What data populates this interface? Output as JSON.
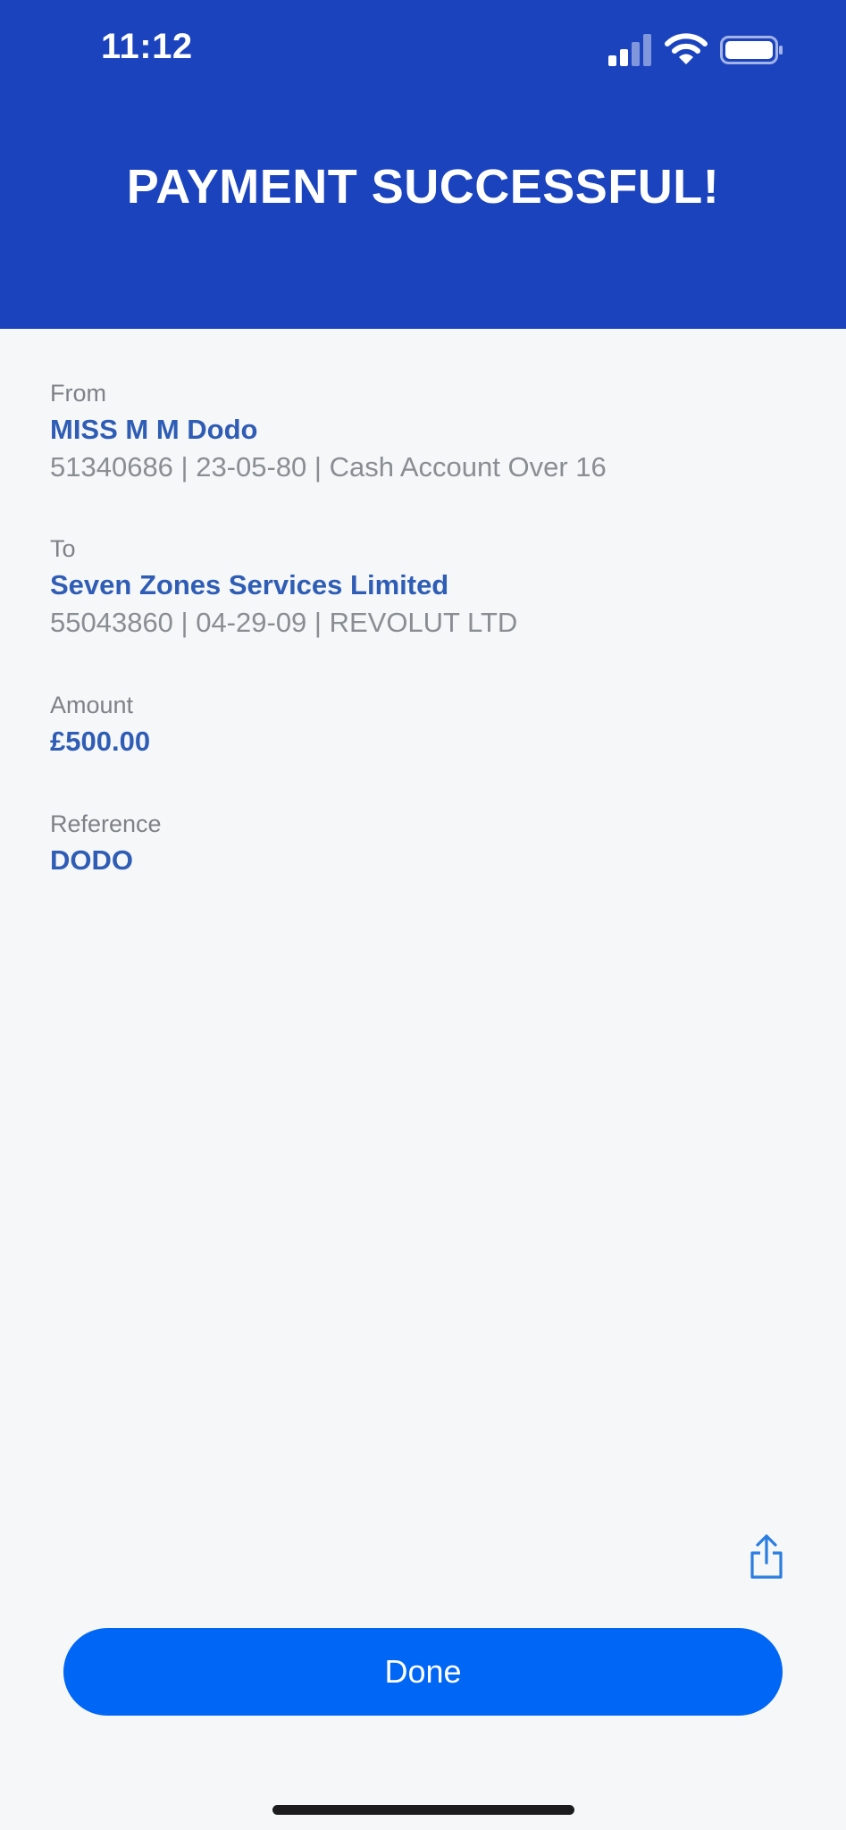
{
  "status_bar": {
    "time": "11:12"
  },
  "header": {
    "title": "PAYMENT SUCCESSFUL!"
  },
  "from": {
    "label": "From",
    "name": "MISS M M Dodo",
    "details": "51340686 | 23-05-80 | Cash Account Over 16"
  },
  "to": {
    "label": "To",
    "name": "Seven Zones Services Limited",
    "details": "55043860 | 04-29-09 | REVOLUT LTD"
  },
  "amount": {
    "label": "Amount",
    "value": "£500.00"
  },
  "reference": {
    "label": "Reference",
    "value": "DODO"
  },
  "actions": {
    "done_label": "Done",
    "share_icon": "share-icon"
  },
  "colors": {
    "header_bg": "#1b43bd",
    "accent_text": "#2f5db5",
    "button_bg": "#0066f5",
    "page_bg": "#f5f7f9"
  }
}
